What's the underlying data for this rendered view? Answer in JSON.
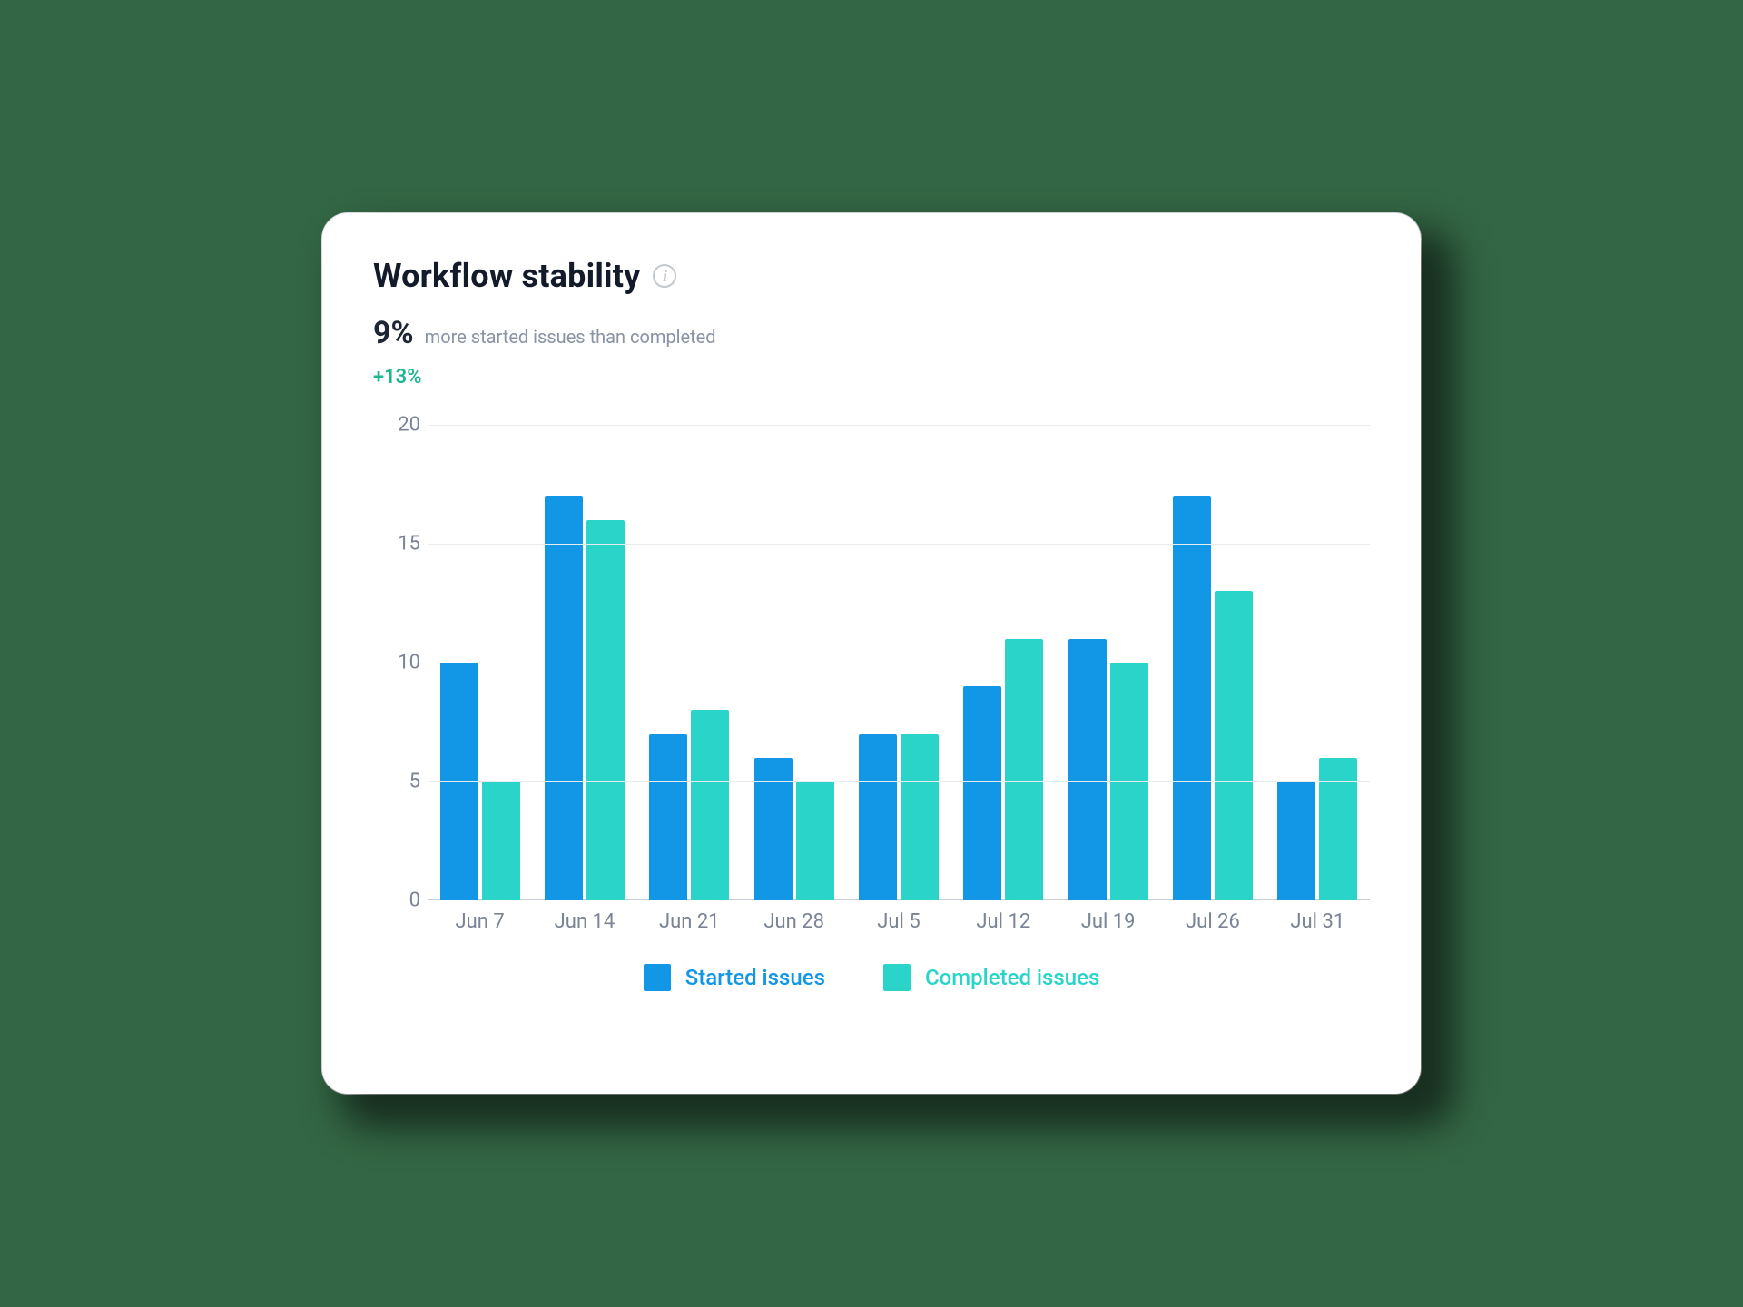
{
  "header": {
    "title": "Workflow stability",
    "info_icon": "i"
  },
  "summary": {
    "value": "9%",
    "description": "more started issues than completed",
    "delta": "+13%"
  },
  "legend": {
    "series0": "Started issues",
    "series1": "Completed issues"
  },
  "colors": {
    "series0": "#1296e6",
    "series1": "#2bd4c8",
    "delta": "#1fb692"
  },
  "chart_data": {
    "type": "bar",
    "title": "Workflow stability",
    "xlabel": "",
    "ylabel": "",
    "ylim": [
      0,
      20
    ],
    "y_ticks": [
      0,
      5,
      10,
      15,
      20
    ],
    "categories": [
      "Jun 7",
      "Jun 14",
      "Jun 21",
      "Jun 28",
      "Jul 5",
      "Jul 12",
      "Jul 19",
      "Jul 26",
      "Jul 31"
    ],
    "series": [
      {
        "name": "Started issues",
        "values": [
          10,
          17,
          7,
          6,
          7,
          9,
          11,
          17,
          5
        ]
      },
      {
        "name": "Completed issues",
        "values": [
          5,
          16,
          8,
          5,
          7,
          11,
          10,
          13,
          6
        ]
      }
    ]
  }
}
